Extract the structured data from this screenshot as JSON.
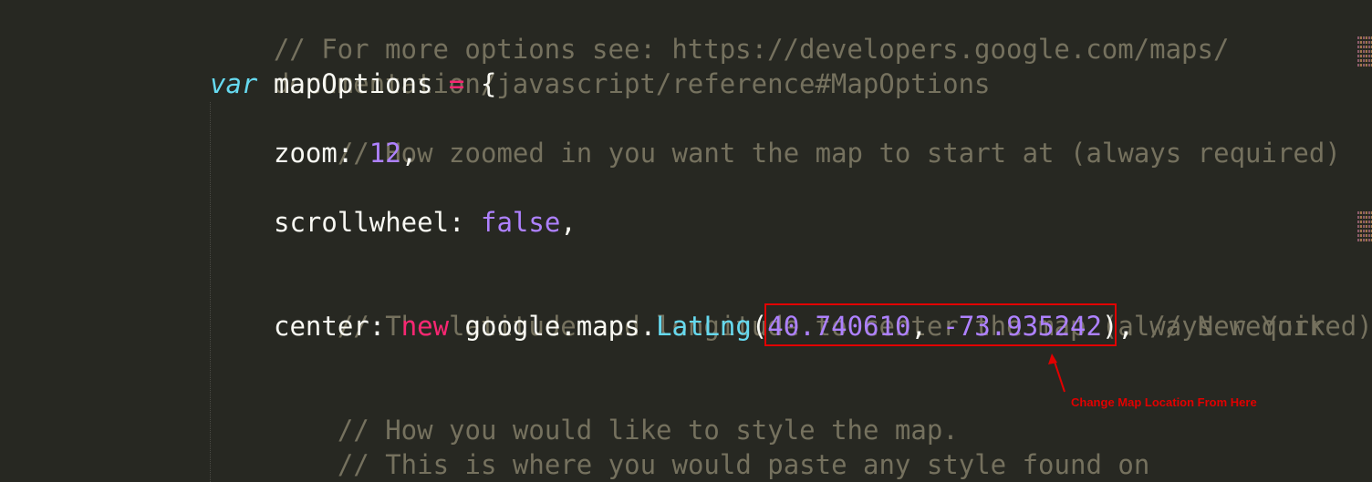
{
  "code_lines": [
    {
      "comment": "// For more options see: https://developers.google.com/maps/"
    },
    {
      "comment": "documentation/javascript/reference#MapOptions"
    },
    {
      "keyword": "var",
      "name": " mapOptions ",
      "op": "=",
      "rest": " {"
    },
    {
      "comment": "// How zoomed in you want the map to start at (always required)"
    },
    {
      "key": "zoom: ",
      "value": "12",
      "rest": ","
    },
    {
      "key": "scrollwheel: ",
      "value": "false",
      "rest": ","
    },
    {
      "comment": "// The latitude and longitude to center the map (always required)"
    },
    {
      "key": "center: ",
      "keyword": "new",
      "obj": " google.maps.",
      "type": "LatLng",
      "open": "(",
      "lat": "40.740610",
      "sep": ", ",
      "lng": "-73.935242",
      "close": "),",
      "comment": " // New York"
    },
    {
      "comment": "// How you would like to style the map."
    },
    {
      "comment": "// This is where you would paste any style found on"
    }
  ],
  "annotation": {
    "text": "Change Map Location From Here",
    "color": "#e10000"
  },
  "colors": {
    "background": "#272822",
    "comment": "#75715e",
    "keyword": "#f92672",
    "number": "#ae81ff",
    "type": "#66d9ef",
    "text": "#f8f8f2"
  }
}
